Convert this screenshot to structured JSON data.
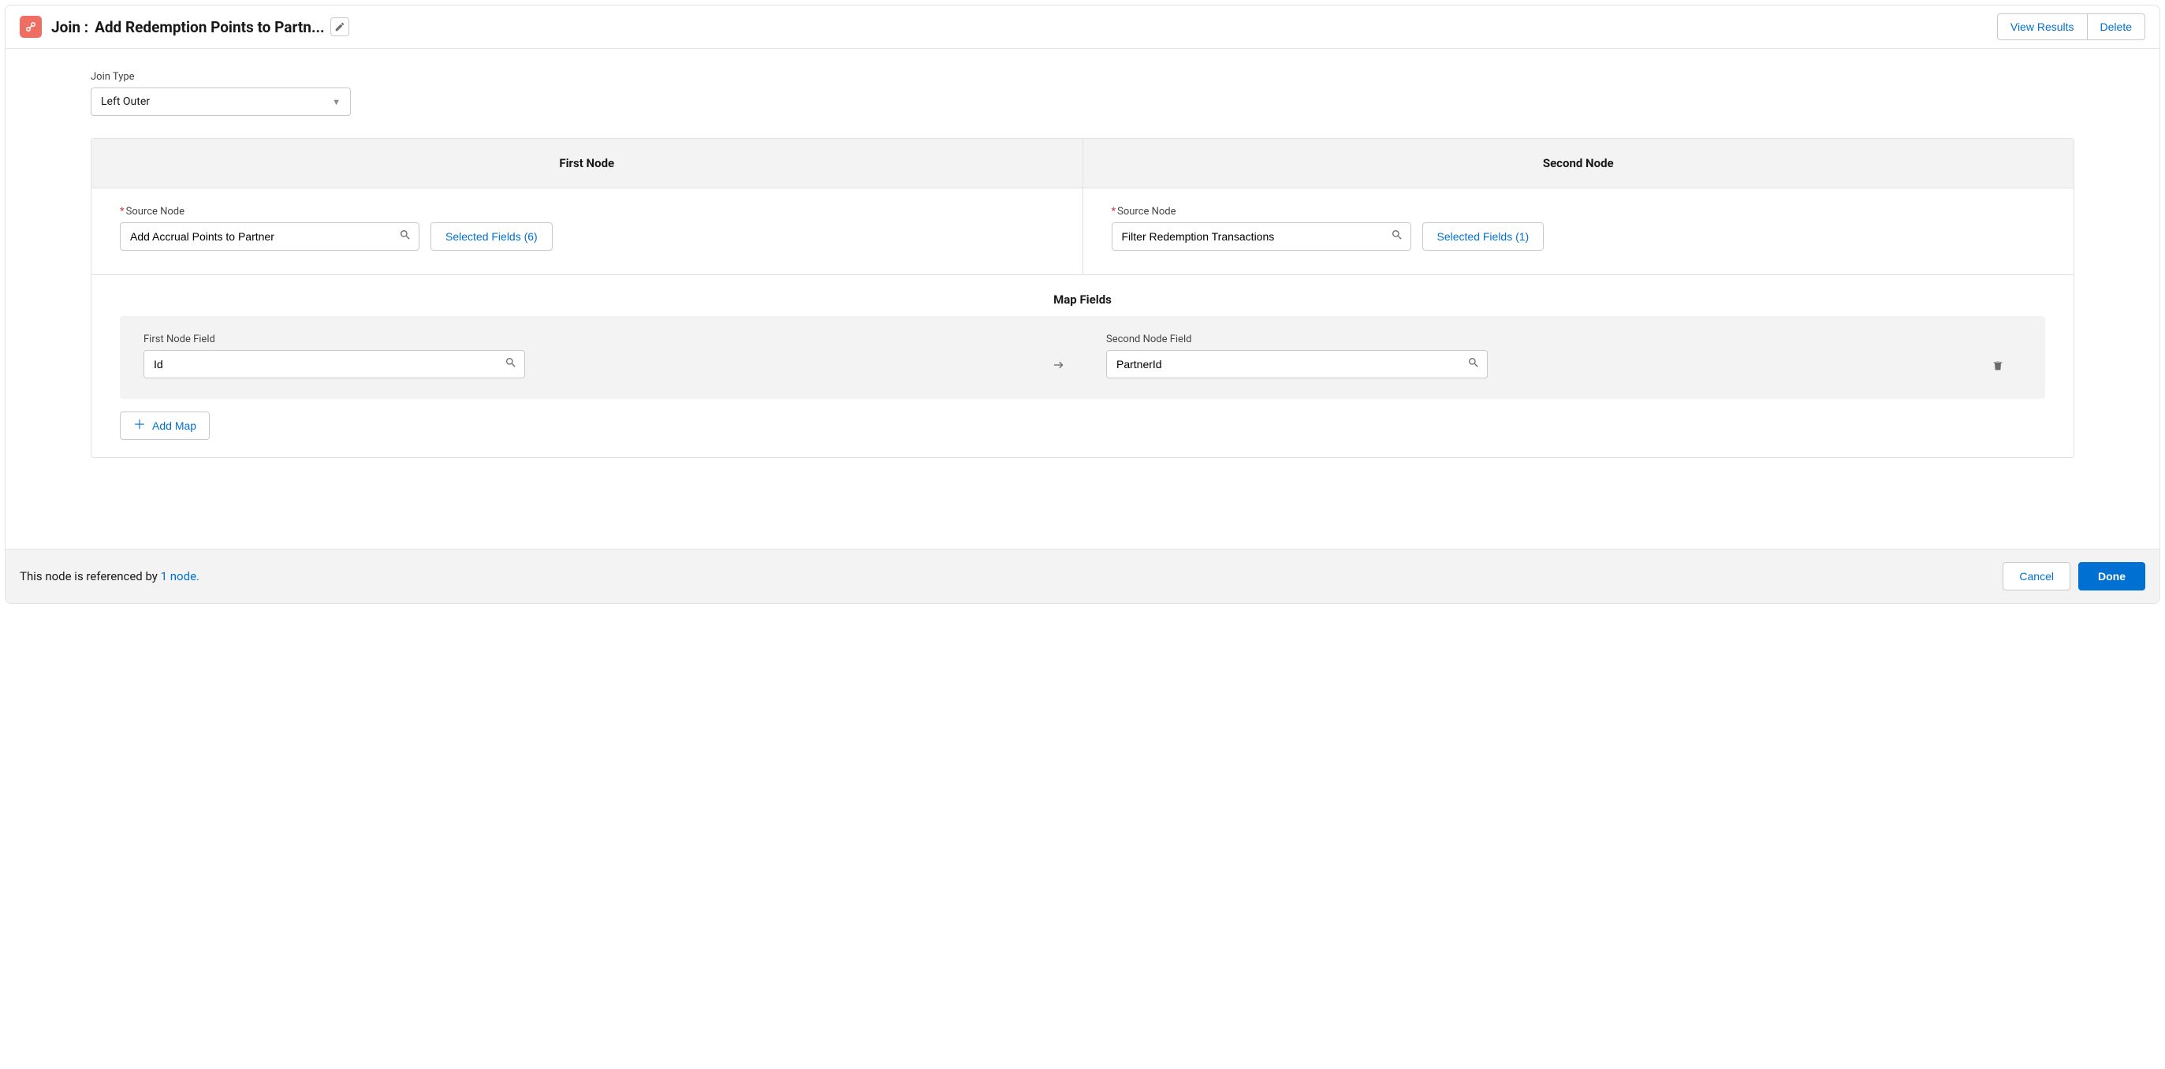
{
  "header": {
    "prefix": "Join :",
    "name": "Add Redemption Points to Partn...",
    "view_results": "View Results",
    "delete": "Delete"
  },
  "join_type": {
    "label": "Join Type",
    "value": "Left Outer"
  },
  "nodes": {
    "first": {
      "header": "First Node",
      "source_label": "Source Node",
      "source_value": "Add Accrual Points to Partner",
      "selected_fields": "Selected Fields (6)"
    },
    "second": {
      "header": "Second Node",
      "source_label": "Source Node",
      "source_value": "Filter Redemption Transactions",
      "selected_fields": "Selected Fields (1)"
    }
  },
  "map": {
    "title": "Map Fields",
    "first_label": "First Node Field",
    "second_label": "Second Node Field",
    "row": {
      "first_value": "Id",
      "second_value": "PartnerId"
    },
    "add_label": "Add Map"
  },
  "footer": {
    "text": "This node is referenced by ",
    "link": "1 node.",
    "cancel": "Cancel",
    "done": "Done"
  }
}
